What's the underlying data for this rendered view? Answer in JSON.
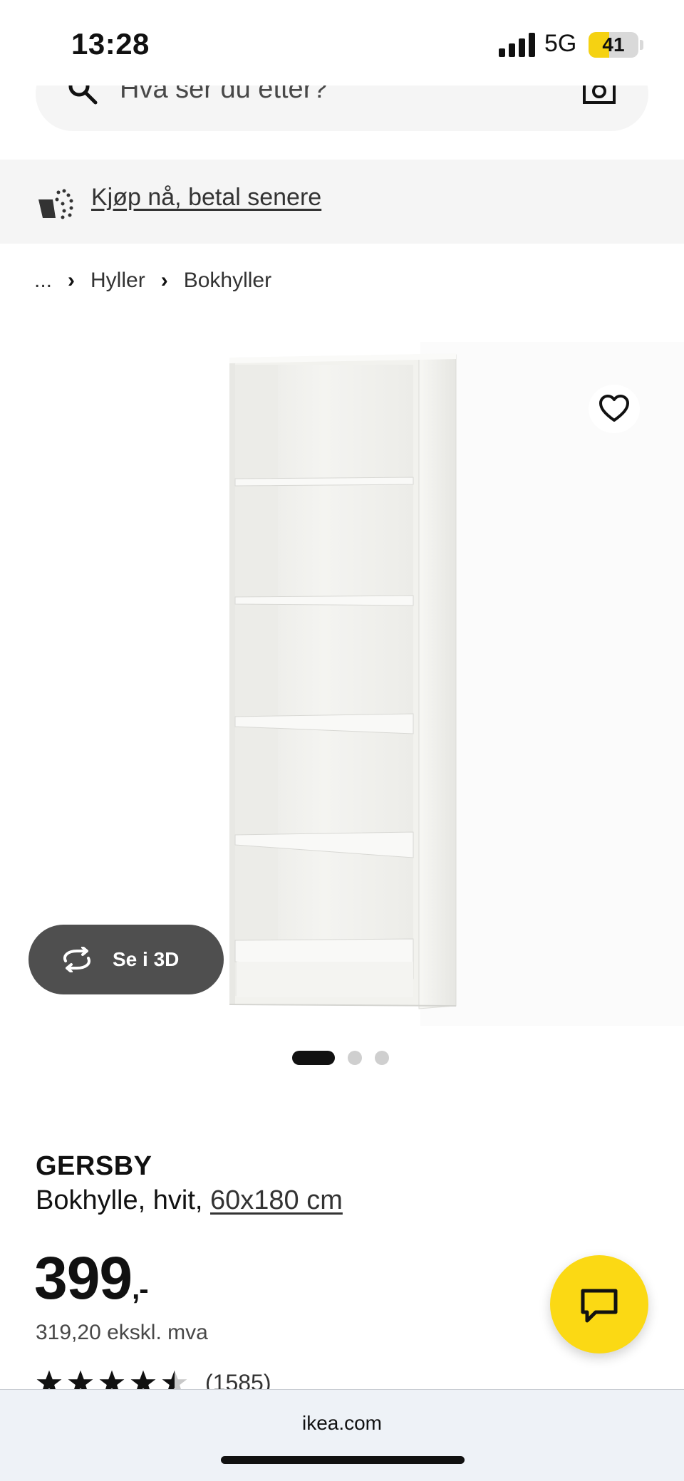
{
  "status_bar": {
    "time": "13:28",
    "network": "5G",
    "battery": "41",
    "battery_level": 0.41
  },
  "search": {
    "placeholder": "Hva ser du etter?"
  },
  "promo": {
    "link": "Kjøp nå, betal senere"
  },
  "breadcrumb": {
    "ellipsis": "...",
    "items": [
      "Hyller",
      "Bokhyller"
    ]
  },
  "gallery": {
    "view_3d": "Se i 3D",
    "slide_count": 3,
    "active_slide": 1
  },
  "product": {
    "name": "GERSBY",
    "description": "Bokhylle, hvit,",
    "size": "60x180 cm",
    "price": "399",
    "price_suffix": ",-",
    "price_excl_vat": "319,20 ekskl. mva",
    "rating": 4.5,
    "review_count": "(1585)"
  },
  "browser": {
    "domain": "ikea.com"
  },
  "colors": {
    "ikea_yellow": "#fbd914",
    "dark_button": "#4f4f4f",
    "panel_gray": "#f5f5f5"
  },
  "icons": [
    "search-icon",
    "camera-icon",
    "basket-icon",
    "heart-icon",
    "rotate-icon",
    "chat-icon",
    "star-icon"
  ]
}
